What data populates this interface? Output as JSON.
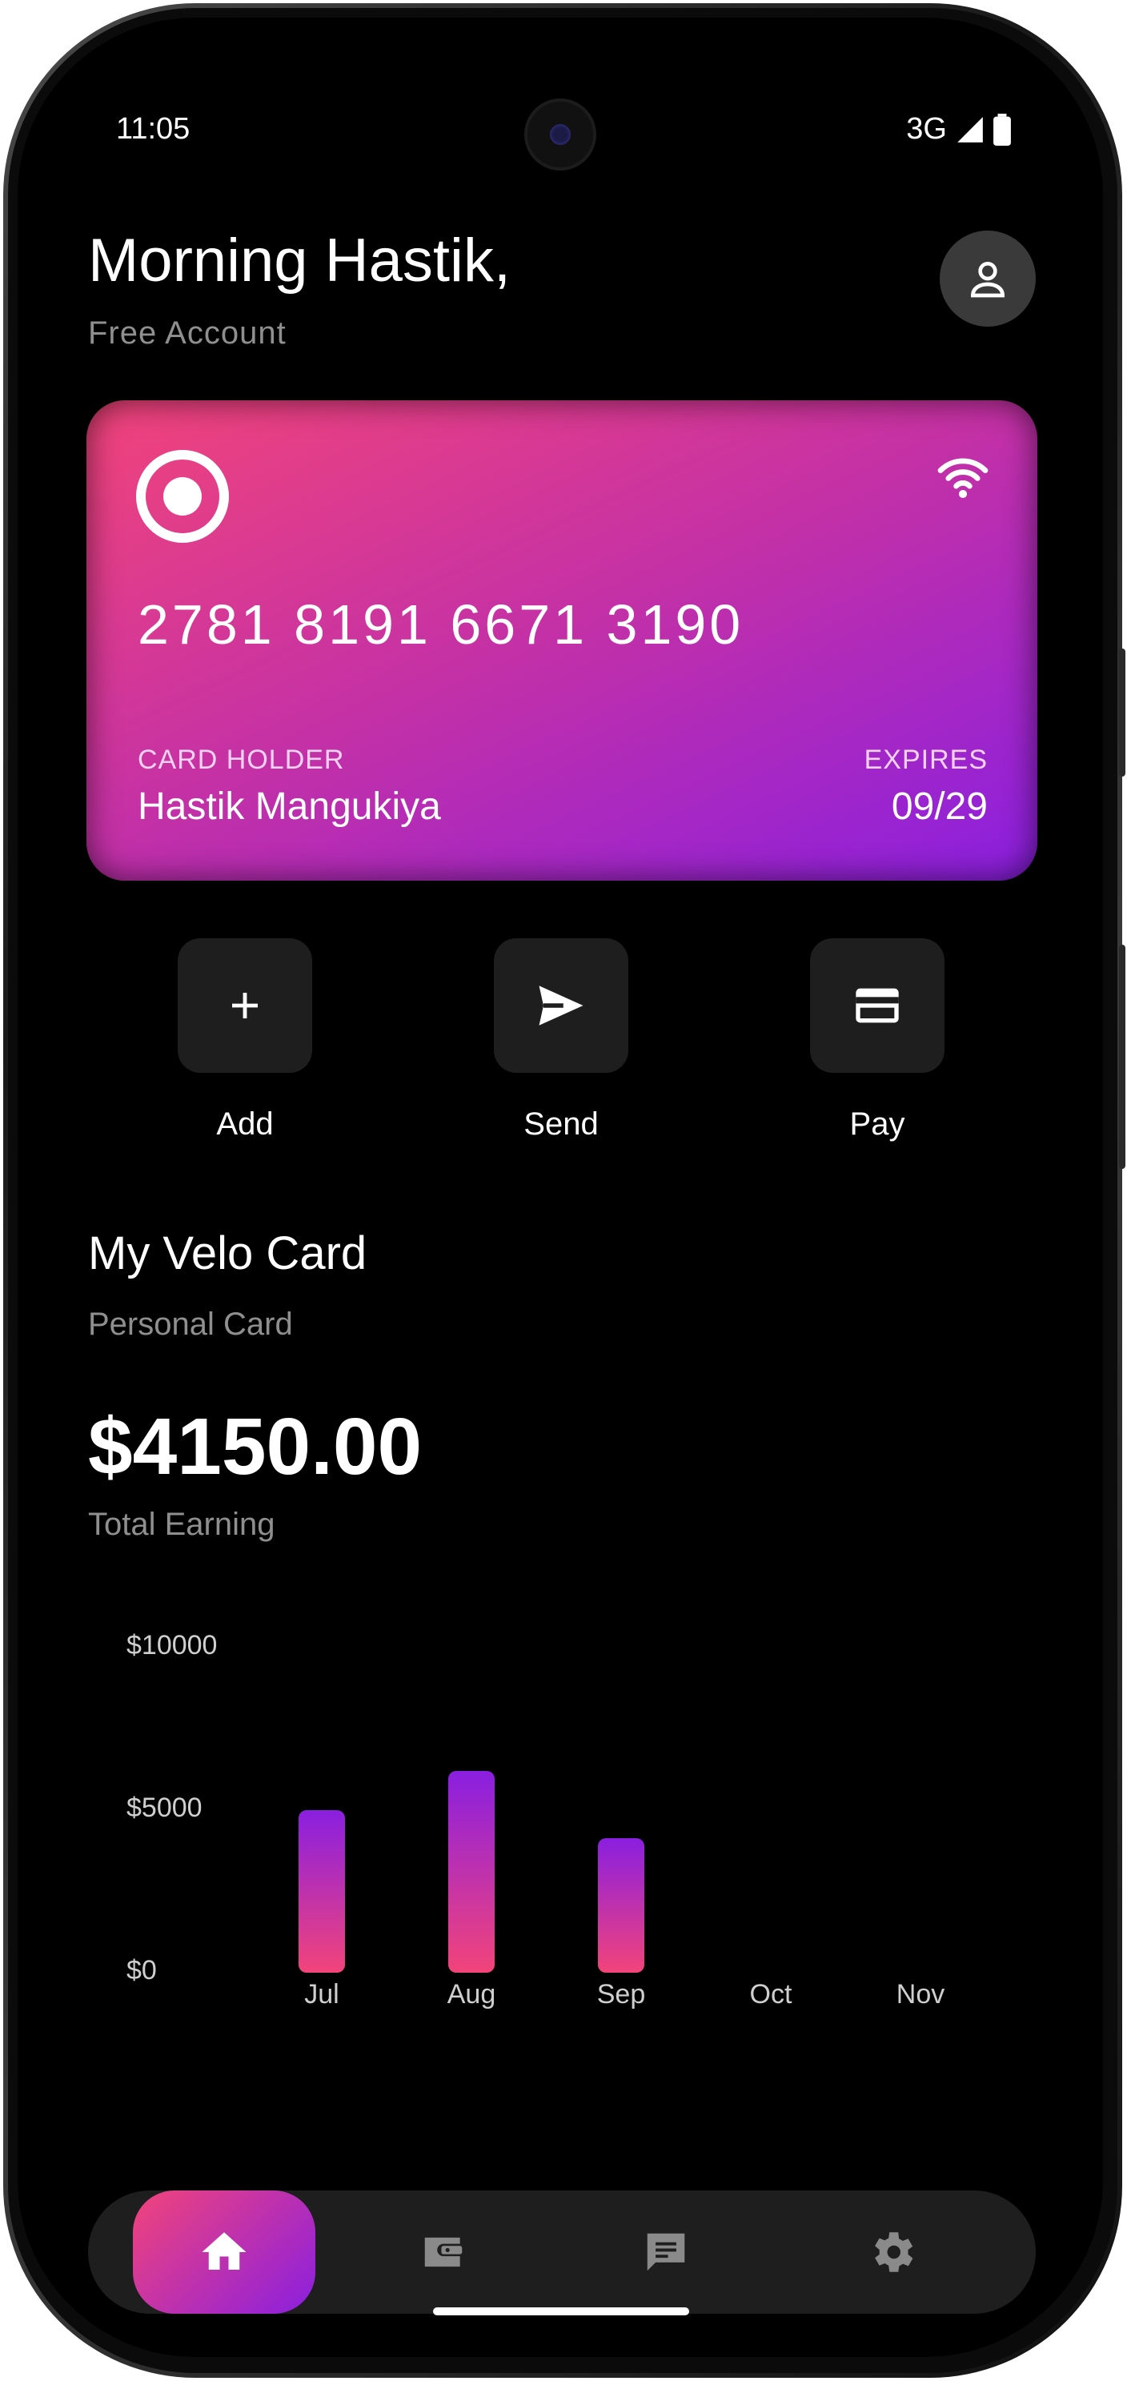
{
  "status_bar": {
    "time": "11:05",
    "network": "3G"
  },
  "header": {
    "greeting": "Morning Hastik,",
    "account_type": "Free Account"
  },
  "card": {
    "number": "2781 8191 6671 3190",
    "holder_label": "CARD HOLDER",
    "holder_name": "Hastik Mangukiya",
    "expires_label": "EXPIRES",
    "expires": "09/29",
    "gradient_colors": [
      "#f2447a",
      "#c230a8",
      "#8a1fe0"
    ]
  },
  "actions": [
    {
      "label": "Add",
      "icon": "plus-icon"
    },
    {
      "label": "Send",
      "icon": "send-icon"
    },
    {
      "label": "Pay",
      "icon": "credit-card-icon"
    }
  ],
  "summary": {
    "title": "My Velo Card",
    "subtitle": "Personal Card",
    "amount": "$4150.00",
    "amount_label": "Total Earning"
  },
  "chart_data": {
    "type": "bar",
    "categories": [
      "Jul",
      "Aug",
      "Sep",
      "Oct",
      "Nov"
    ],
    "values": [
      5000,
      6200,
      4150,
      0,
      0
    ],
    "yticks": [
      "$10000",
      "$5000",
      "$0"
    ],
    "ylim": [
      0,
      10000
    ],
    "grid": false,
    "bar_gradient": [
      "#8a1fe0",
      "#f2447a"
    ]
  },
  "bottom_nav": [
    {
      "name": "home",
      "icon": "home-icon",
      "active": true
    },
    {
      "name": "wallet",
      "icon": "wallet-icon",
      "active": false
    },
    {
      "name": "messages",
      "icon": "message-icon",
      "active": false
    },
    {
      "name": "settings",
      "icon": "gear-icon",
      "active": false
    }
  ],
  "colors": {
    "background": "#000000",
    "surface": "#1e1e1e",
    "muted_text": "#8f8f8f"
  }
}
